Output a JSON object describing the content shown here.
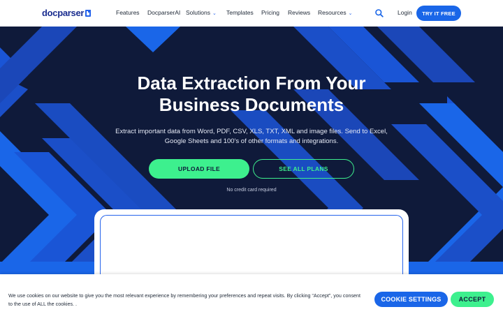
{
  "brand": {
    "logo_text": "docparser"
  },
  "nav": {
    "items": [
      {
        "label": "Features"
      },
      {
        "label": "DocparserAI"
      },
      {
        "label": "Solutions",
        "has_dropdown": true
      },
      {
        "label": "Templates"
      },
      {
        "label": "Pricing"
      },
      {
        "label": "Reviews"
      },
      {
        "label": "Resources",
        "has_dropdown": true
      }
    ],
    "search_icon": "search-icon",
    "login_label": "Login",
    "cta_label": "TRY IT FREE"
  },
  "hero": {
    "title_line1": "Data Extraction From Your",
    "title_line2": "Business Documents",
    "subtitle_line1": "Extract important data from Word, PDF, CSV, XLS, TXT, XML and image files. Send to Excel,",
    "subtitle_line2": "Google Sheets and 100's of other formats and integrations.",
    "primary_button": "UPLOAD FILE",
    "secondary_button": "SEE ALL PLANS",
    "note": "No credit card required"
  },
  "cookie_bar": {
    "text_line1": "We use cookies on our website to give you the most relevant experience by remembering your preferences and repeat visits. By clicking “Accept”, you consent",
    "text_line2": "to the use of ALL the cookies. .",
    "settings_label": "COOKIE SETTINGS",
    "accept_label": "ACCEPT"
  },
  "colors": {
    "accent_blue": "#1a66e8",
    "accent_green": "#3df08e",
    "hero_bg": "#0f1a3a"
  }
}
